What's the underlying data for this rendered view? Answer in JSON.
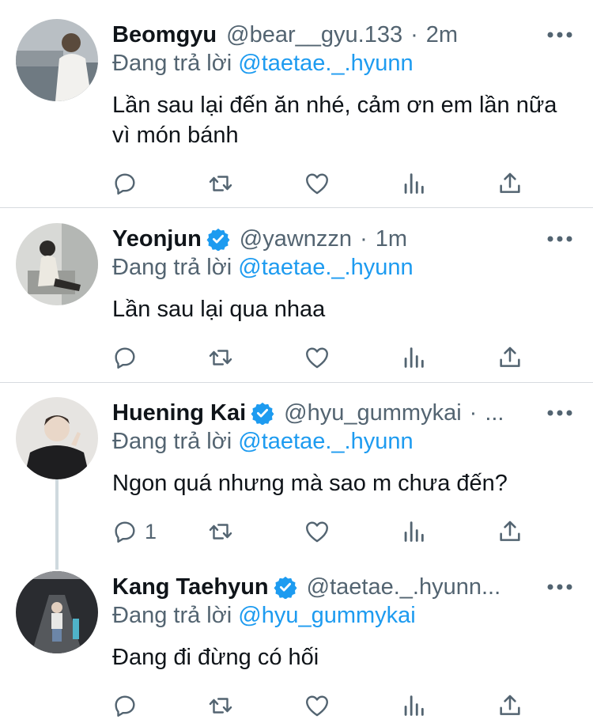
{
  "replying_prefix": "Đang trả lời",
  "tweets": [
    {
      "name": "Beomgyu",
      "verified": false,
      "handle": "@bear__gyu.133",
      "dot": "·",
      "time": "2m",
      "reply_to": "@taetae._.hyunn",
      "text": "Lần sau lại đến ăn nhé, cảm ơn em lần nữa vì món bánh",
      "reply_count": ""
    },
    {
      "name": "Yeonjun",
      "verified": true,
      "handle": "@yawnzzn",
      "dot": "·",
      "time": "1m",
      "reply_to": "@taetae._.hyunn",
      "text": "Lần sau lại qua nhaa",
      "reply_count": ""
    },
    {
      "name": "Huening Kai",
      "verified": true,
      "handle": "@hyu_gummykai",
      "dot": "·",
      "time": "...",
      "reply_to": "@taetae._.hyunn",
      "text": "Ngon quá nhưng mà sao m chưa đến?",
      "reply_count": "1"
    },
    {
      "name": "Kang Taehyun",
      "verified": true,
      "handle": "@taetae._.hyunn...",
      "dot": "",
      "time": "",
      "reply_to": "@hyu_gummykai",
      "text": "Đang đi đừng có hối",
      "reply_count": ""
    }
  ],
  "colors": {
    "accent": "#1d9bf0",
    "secondary_text": "#536471",
    "primary_text": "#0f1419",
    "divider": "#d7dbdf"
  },
  "icons": [
    "reply-icon",
    "retweet-icon",
    "like-icon",
    "views-icon",
    "share-icon",
    "more-icon",
    "verified-badge-icon"
  ]
}
